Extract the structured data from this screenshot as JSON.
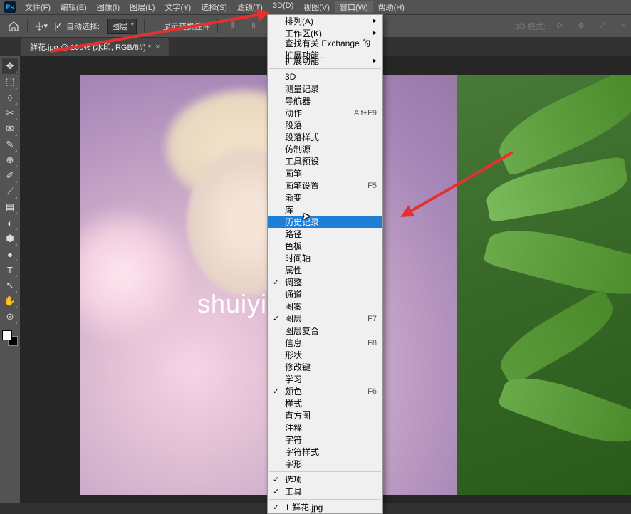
{
  "menubar": {
    "items": [
      "文件(F)",
      "编辑(E)",
      "图像(I)",
      "图层(L)",
      "文字(Y)",
      "选择(S)",
      "滤镜(T)",
      "3D(D)",
      "视图(V)",
      "窗口(W)",
      "帮助(H)"
    ],
    "active_index": 9
  },
  "optbar": {
    "auto_select_label": "自动选择:",
    "auto_select_value": "图层",
    "show_transform_label": "显示变换控件",
    "mode3d_label": "3D 模式:"
  },
  "tab": {
    "title": "鲜花.jpg @ 100% (水印, RGB/8#) *"
  },
  "watermark": "shuiyin",
  "tools": [
    "✥",
    "⬚",
    "◊",
    "✂",
    "✉",
    "✎",
    "⊕",
    "✐",
    "⟋",
    "▤",
    "◐",
    "⬢",
    "●",
    "T",
    "↖",
    "✋",
    "⊙"
  ],
  "dropdown": {
    "groups": [
      [
        {
          "label": "排列(A)",
          "sub": true
        },
        {
          "label": "工作区(K)",
          "sub": true
        }
      ],
      [
        {
          "label": "查找有关 Exchange 的扩展功能..."
        },
        {
          "label": "扩展功能",
          "sub": true
        }
      ],
      [
        {
          "label": "3D"
        },
        {
          "label": "测量记录"
        },
        {
          "label": "导航器"
        },
        {
          "label": "动作",
          "shortcut": "Alt+F9"
        },
        {
          "label": "段落"
        },
        {
          "label": "段落样式"
        },
        {
          "label": "仿制源"
        },
        {
          "label": "工具预设"
        },
        {
          "label": "画笔"
        },
        {
          "label": "画笔设置",
          "shortcut": "F5"
        },
        {
          "label": "渐变"
        },
        {
          "label": "库"
        },
        {
          "label": "历史记录",
          "highlighted": true
        },
        {
          "label": "路径"
        },
        {
          "label": "色板"
        },
        {
          "label": "时间轴"
        },
        {
          "label": "属性"
        },
        {
          "label": "调整",
          "checked": true
        },
        {
          "label": "通道"
        },
        {
          "label": "图案"
        },
        {
          "label": "图层",
          "checked": true,
          "shortcut": "F7"
        },
        {
          "label": "图层复合"
        },
        {
          "label": "信息",
          "shortcut": "F8"
        },
        {
          "label": "形状"
        },
        {
          "label": "修改键"
        },
        {
          "label": "学习"
        },
        {
          "label": "颜色",
          "checked": true,
          "shortcut": "F6"
        },
        {
          "label": "样式"
        },
        {
          "label": "直方图"
        },
        {
          "label": "注释"
        },
        {
          "label": "字符"
        },
        {
          "label": "字符样式"
        },
        {
          "label": "字形"
        }
      ],
      [
        {
          "label": "选项",
          "checked": true
        },
        {
          "label": "工具",
          "checked": true
        }
      ],
      [
        {
          "label": "1 鲜花.jpg",
          "checked": true
        }
      ]
    ]
  }
}
